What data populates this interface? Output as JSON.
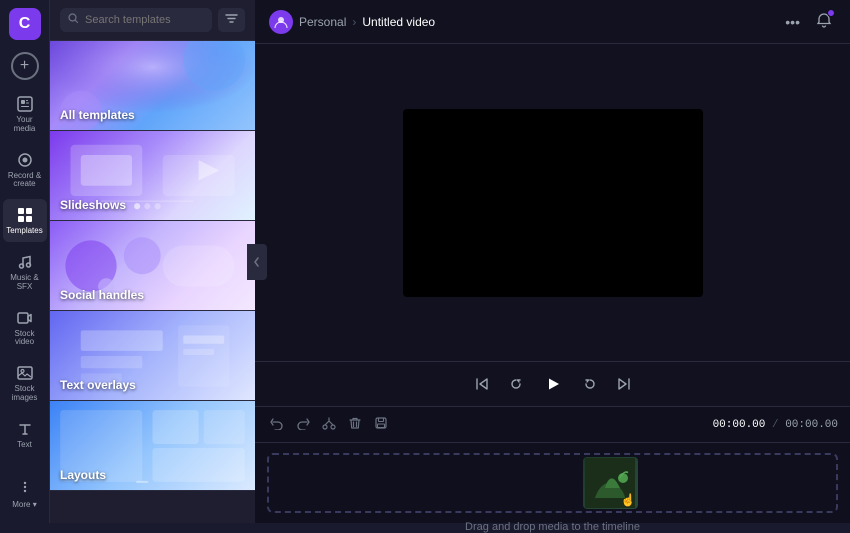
{
  "app": {
    "logo": "C",
    "title": "Untitled video"
  },
  "nav": {
    "add_btn": "+",
    "items": [
      {
        "id": "your-media",
        "label": "Your media",
        "icon": "▣"
      },
      {
        "id": "record-create",
        "label": "Record &\ncreate",
        "icon": "⏺"
      },
      {
        "id": "templates",
        "label": "Templates",
        "icon": "⊞",
        "active": true
      },
      {
        "id": "music-sfx",
        "label": "Music & SFX",
        "icon": "♪"
      },
      {
        "id": "stock-video",
        "label": "Stock video",
        "icon": "▶"
      },
      {
        "id": "stock-images",
        "label": "Stock images",
        "icon": "🖼"
      },
      {
        "id": "text",
        "label": "Text",
        "icon": "T"
      }
    ],
    "more_label": "More"
  },
  "search": {
    "placeholder": "Search templates",
    "filter_icon": "≡"
  },
  "templates": [
    {
      "id": "all-templates",
      "label": "All templates",
      "bg_class": "bg-all"
    },
    {
      "id": "slideshows",
      "label": "Slideshows",
      "bg_class": "bg-slideshows"
    },
    {
      "id": "social-handles",
      "label": "Social handles",
      "bg_class": "bg-social"
    },
    {
      "id": "text-overlays",
      "label": "Text overlays",
      "bg_class": "bg-text"
    },
    {
      "id": "layouts",
      "label": "Layouts",
      "bg_class": "bg-layouts"
    }
  ],
  "breadcrumb": {
    "home": "Personal",
    "sep": "›",
    "current": "Untitled video"
  },
  "playback": {
    "skip_back": "⏮",
    "rewind": "↺",
    "play": "▶",
    "forward": "↻",
    "skip_forward": "⏭",
    "time_current": "00:00.00",
    "time_sep": "/",
    "time_total": "00:00.00"
  },
  "timeline": {
    "undo": "↩",
    "redo": "↪",
    "cut": "✂",
    "delete": "🗑",
    "save": "💾",
    "drop_label": "Drag and drop media to the timeline"
  }
}
